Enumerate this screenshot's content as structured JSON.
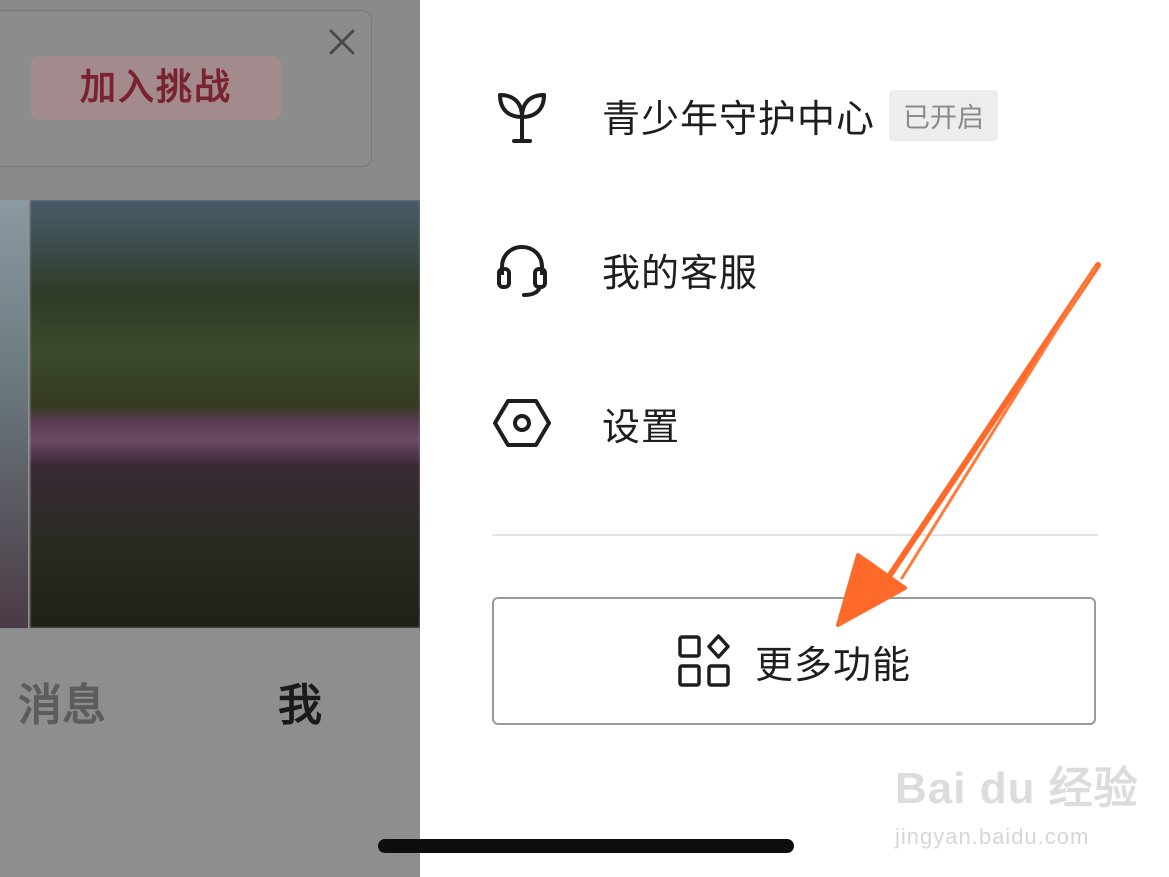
{
  "background": {
    "challenge_card": {
      "join_label": "加入挑战",
      "close_icon": "close-icon"
    },
    "bottom_nav": {
      "tabs": [
        {
          "label": "消息"
        },
        {
          "label": "我"
        }
      ]
    }
  },
  "drawer": {
    "menu_items": [
      {
        "label": "青少年守护中心",
        "icon": "sprout-icon",
        "badge": "已开启"
      },
      {
        "label": "我的客服",
        "icon": "headset-icon"
      },
      {
        "label": "设置",
        "icon": "settings-hexagon-icon"
      }
    ],
    "more_features": {
      "label": "更多功能",
      "icon": "grid-apps-icon"
    }
  },
  "watermark": {
    "logo": "Bai du 经验",
    "url": "jingyan.baidu.com"
  },
  "colors": {
    "annotation_arrow": "#ff6a2b",
    "dim_overlay": "#8a8a8a"
  }
}
